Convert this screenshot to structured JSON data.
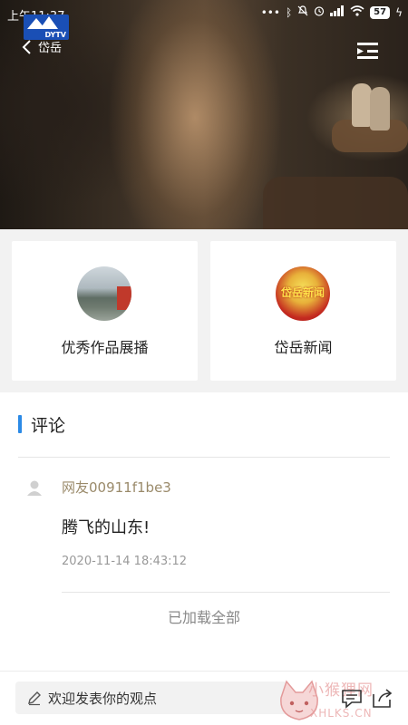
{
  "status_bar": {
    "time": "上午11:37",
    "battery": "57"
  },
  "header": {
    "logo_brand": "DYTV",
    "logo_text": "岱岳"
  },
  "cards": [
    {
      "label": "优秀作品展播"
    },
    {
      "label": "岱岳新闻",
      "thumb_caption": "岱岳新闻"
    }
  ],
  "comments": {
    "section_title": "评论",
    "items": [
      {
        "user": "网友00911f1be3",
        "text": "腾飞的山东!",
        "time": "2020-11-14 18:43:12"
      }
    ],
    "loaded_all": "已加载全部"
  },
  "bottom_bar": {
    "input_placeholder": "欢迎发表你的观点",
    "watermark": "小猴狸网",
    "watermark_domain": "XHLKS.CN"
  },
  "colors": {
    "accent": "#2b8ae6",
    "username": "#9a8a6a"
  }
}
